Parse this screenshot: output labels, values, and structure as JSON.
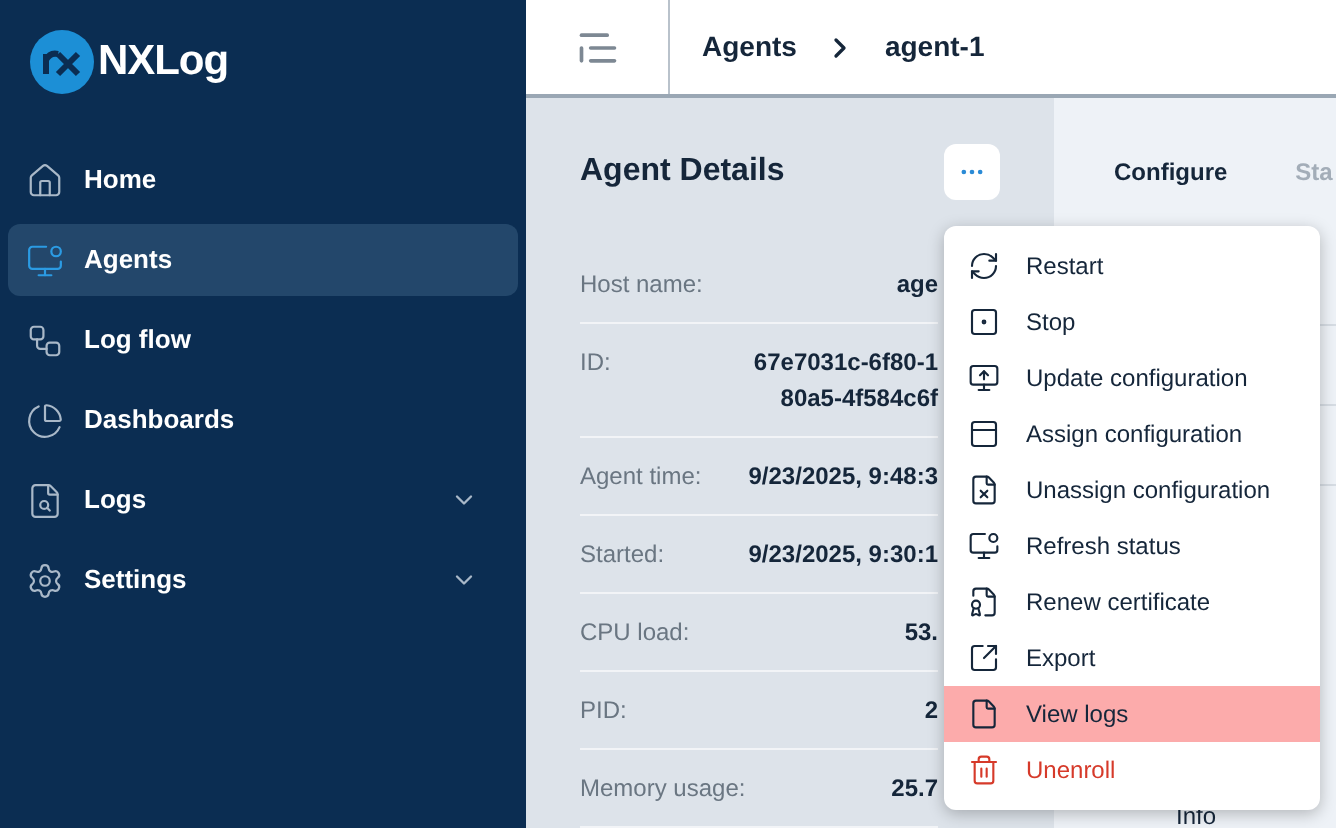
{
  "sidebar": {
    "logo": "NXLog",
    "items": [
      {
        "label": "Home",
        "selected": false
      },
      {
        "label": "Agents",
        "selected": true
      },
      {
        "label": "Log flow",
        "selected": false
      },
      {
        "label": "Dashboards",
        "selected": false
      },
      {
        "label": "Logs",
        "selected": false,
        "expandable": true
      },
      {
        "label": "Settings",
        "selected": false,
        "expandable": true
      }
    ]
  },
  "breadcrumb": [
    "Agents",
    "agent-1"
  ],
  "details": {
    "title": "Agent Details",
    "rows": [
      {
        "label": "Host name:",
        "value": [
          "age"
        ]
      },
      {
        "label": "ID:",
        "value": [
          "67e7031c-6f80-1",
          "80a5-4f584c6f"
        ]
      },
      {
        "label": "Agent time:",
        "value": [
          "9/23/2025, 9:48:3"
        ]
      },
      {
        "label": "Started:",
        "value": [
          "9/23/2025, 9:30:1"
        ]
      },
      {
        "label": "CPU load:",
        "value": [
          "53."
        ]
      },
      {
        "label": "PID:",
        "value": [
          "2"
        ]
      },
      {
        "label": "Memory usage:",
        "value": [
          "25.7"
        ]
      }
    ]
  },
  "tabs": [
    {
      "label": "Configure",
      "selected": true
    },
    {
      "label": "Sta",
      "selected": false
    }
  ],
  "right_panel": {
    "bottom": "Info"
  },
  "menu": [
    {
      "label": "Restart",
      "selected": false,
      "kind": "normal"
    },
    {
      "label": "Stop",
      "selected": false,
      "kind": "normal"
    },
    {
      "label": "Update configuration",
      "selected": false,
      "kind": "normal"
    },
    {
      "label": "Assign configuration",
      "selected": false,
      "kind": "normal"
    },
    {
      "label": "Unassign configuration",
      "selected": false,
      "kind": "normal"
    },
    {
      "label": "Refresh status",
      "selected": false,
      "kind": "normal"
    },
    {
      "label": "Renew certificate",
      "selected": false,
      "kind": "normal"
    },
    {
      "label": "Export",
      "selected": false,
      "kind": "normal"
    },
    {
      "label": "View logs",
      "selected": true,
      "kind": "normal"
    },
    {
      "label": "Unenroll",
      "selected": false,
      "kind": "danger"
    }
  ]
}
